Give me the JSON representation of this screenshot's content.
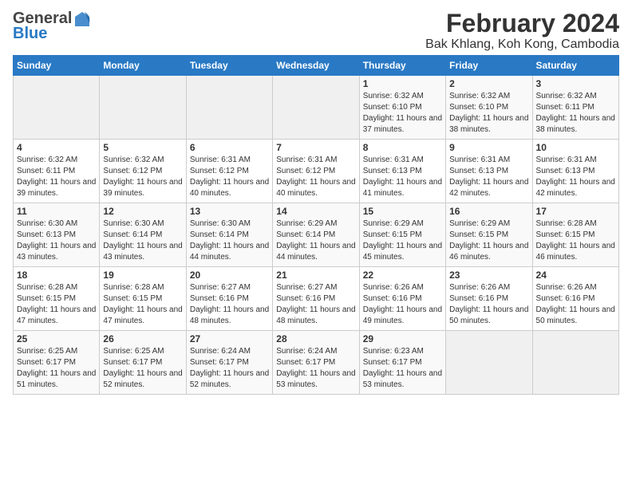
{
  "logo": {
    "general": "General",
    "blue": "Blue"
  },
  "title": "February 2024",
  "location": "Bak Khlang, Koh Kong, Cambodia",
  "days_header": [
    "Sunday",
    "Monday",
    "Tuesday",
    "Wednesday",
    "Thursday",
    "Friday",
    "Saturday"
  ],
  "weeks": [
    [
      {
        "num": "",
        "info": ""
      },
      {
        "num": "",
        "info": ""
      },
      {
        "num": "",
        "info": ""
      },
      {
        "num": "",
        "info": ""
      },
      {
        "num": "1",
        "info": "Sunrise: 6:32 AM\nSunset: 6:10 PM\nDaylight: 11 hours and 37 minutes."
      },
      {
        "num": "2",
        "info": "Sunrise: 6:32 AM\nSunset: 6:10 PM\nDaylight: 11 hours and 38 minutes."
      },
      {
        "num": "3",
        "info": "Sunrise: 6:32 AM\nSunset: 6:11 PM\nDaylight: 11 hours and 38 minutes."
      }
    ],
    [
      {
        "num": "4",
        "info": "Sunrise: 6:32 AM\nSunset: 6:11 PM\nDaylight: 11 hours and 39 minutes."
      },
      {
        "num": "5",
        "info": "Sunrise: 6:32 AM\nSunset: 6:12 PM\nDaylight: 11 hours and 39 minutes."
      },
      {
        "num": "6",
        "info": "Sunrise: 6:31 AM\nSunset: 6:12 PM\nDaylight: 11 hours and 40 minutes."
      },
      {
        "num": "7",
        "info": "Sunrise: 6:31 AM\nSunset: 6:12 PM\nDaylight: 11 hours and 40 minutes."
      },
      {
        "num": "8",
        "info": "Sunrise: 6:31 AM\nSunset: 6:13 PM\nDaylight: 11 hours and 41 minutes."
      },
      {
        "num": "9",
        "info": "Sunrise: 6:31 AM\nSunset: 6:13 PM\nDaylight: 11 hours and 42 minutes."
      },
      {
        "num": "10",
        "info": "Sunrise: 6:31 AM\nSunset: 6:13 PM\nDaylight: 11 hours and 42 minutes."
      }
    ],
    [
      {
        "num": "11",
        "info": "Sunrise: 6:30 AM\nSunset: 6:13 PM\nDaylight: 11 hours and 43 minutes."
      },
      {
        "num": "12",
        "info": "Sunrise: 6:30 AM\nSunset: 6:14 PM\nDaylight: 11 hours and 43 minutes."
      },
      {
        "num": "13",
        "info": "Sunrise: 6:30 AM\nSunset: 6:14 PM\nDaylight: 11 hours and 44 minutes."
      },
      {
        "num": "14",
        "info": "Sunrise: 6:29 AM\nSunset: 6:14 PM\nDaylight: 11 hours and 44 minutes."
      },
      {
        "num": "15",
        "info": "Sunrise: 6:29 AM\nSunset: 6:15 PM\nDaylight: 11 hours and 45 minutes."
      },
      {
        "num": "16",
        "info": "Sunrise: 6:29 AM\nSunset: 6:15 PM\nDaylight: 11 hours and 46 minutes."
      },
      {
        "num": "17",
        "info": "Sunrise: 6:28 AM\nSunset: 6:15 PM\nDaylight: 11 hours and 46 minutes."
      }
    ],
    [
      {
        "num": "18",
        "info": "Sunrise: 6:28 AM\nSunset: 6:15 PM\nDaylight: 11 hours and 47 minutes."
      },
      {
        "num": "19",
        "info": "Sunrise: 6:28 AM\nSunset: 6:15 PM\nDaylight: 11 hours and 47 minutes."
      },
      {
        "num": "20",
        "info": "Sunrise: 6:27 AM\nSunset: 6:16 PM\nDaylight: 11 hours and 48 minutes."
      },
      {
        "num": "21",
        "info": "Sunrise: 6:27 AM\nSunset: 6:16 PM\nDaylight: 11 hours and 48 minutes."
      },
      {
        "num": "22",
        "info": "Sunrise: 6:26 AM\nSunset: 6:16 PM\nDaylight: 11 hours and 49 minutes."
      },
      {
        "num": "23",
        "info": "Sunrise: 6:26 AM\nSunset: 6:16 PM\nDaylight: 11 hours and 50 minutes."
      },
      {
        "num": "24",
        "info": "Sunrise: 6:26 AM\nSunset: 6:16 PM\nDaylight: 11 hours and 50 minutes."
      }
    ],
    [
      {
        "num": "25",
        "info": "Sunrise: 6:25 AM\nSunset: 6:17 PM\nDaylight: 11 hours and 51 minutes."
      },
      {
        "num": "26",
        "info": "Sunrise: 6:25 AM\nSunset: 6:17 PM\nDaylight: 11 hours and 52 minutes."
      },
      {
        "num": "27",
        "info": "Sunrise: 6:24 AM\nSunset: 6:17 PM\nDaylight: 11 hours and 52 minutes."
      },
      {
        "num": "28",
        "info": "Sunrise: 6:24 AM\nSunset: 6:17 PM\nDaylight: 11 hours and 53 minutes."
      },
      {
        "num": "29",
        "info": "Sunrise: 6:23 AM\nSunset: 6:17 PM\nDaylight: 11 hours and 53 minutes."
      },
      {
        "num": "",
        "info": ""
      },
      {
        "num": "",
        "info": ""
      }
    ]
  ]
}
